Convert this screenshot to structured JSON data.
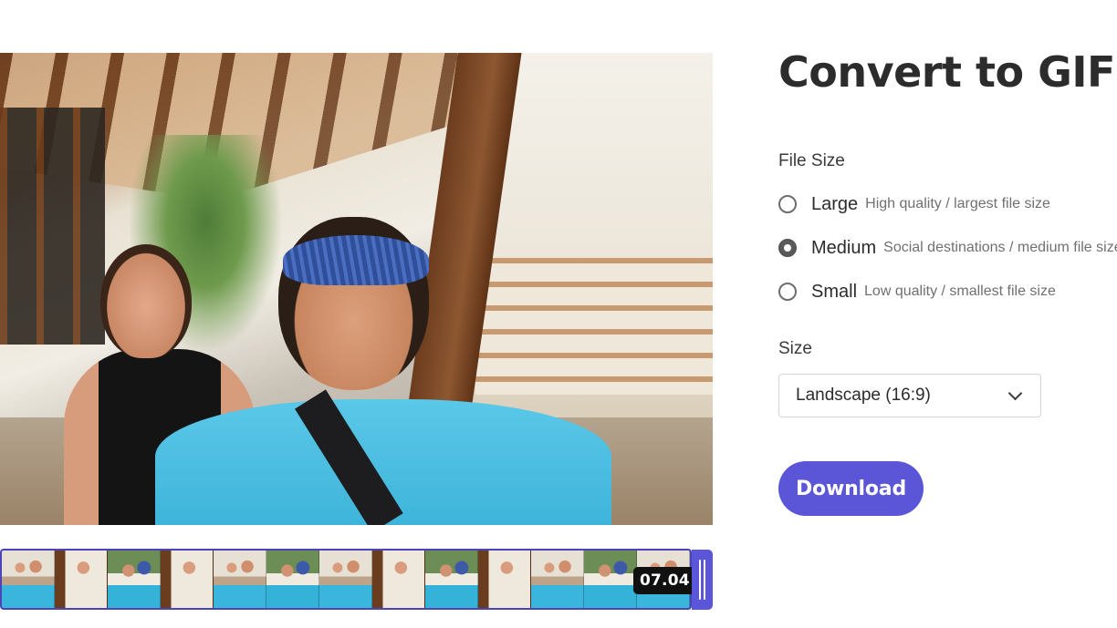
{
  "app": {
    "title": "Convert to GIF"
  },
  "preview": {
    "image_description": "video-frame"
  },
  "file_size": {
    "label": "File Size",
    "options": [
      {
        "label": "Large",
        "description": "High quality / largest file size",
        "selected": false
      },
      {
        "label": "Medium",
        "description": "Social destinations / medium file size",
        "selected": true
      },
      {
        "label": "Small",
        "description": "Low quality / smallest file size",
        "selected": false
      }
    ]
  },
  "size": {
    "label": "Size",
    "selected": "Landscape (16:9)"
  },
  "actions": {
    "download_label": "Download"
  },
  "timeline": {
    "duration": "07.04",
    "frame_count": 13
  },
  "colors": {
    "accent": "#5b55d8",
    "filmstrip_border": "#4a44b8"
  }
}
